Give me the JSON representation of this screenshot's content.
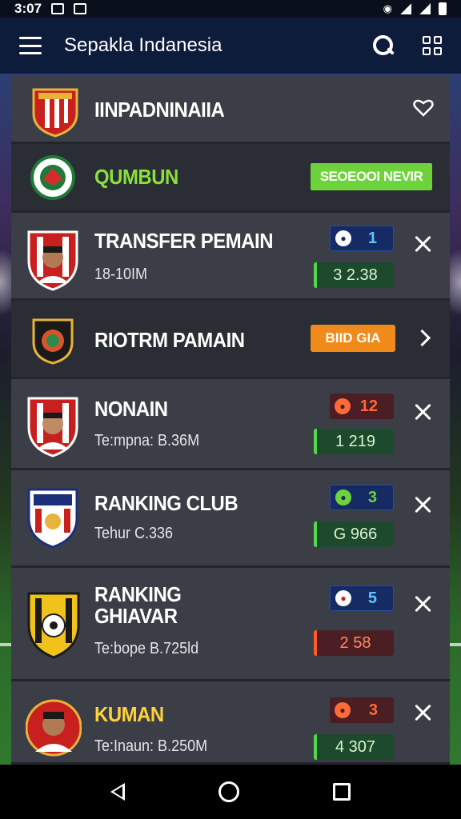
{
  "status_bar": {
    "time": "3:07"
  },
  "app_bar": {
    "title": "Sepakla Indanesia"
  },
  "icons": {
    "menu": "hamburger-menu-icon",
    "search": "search-icon",
    "grid": "grid-scan-icon",
    "close": "close-icon",
    "favorite": "heart-icon",
    "chevron": "chevron-right-icon"
  },
  "colors": {
    "accent_green": "#6ed33a",
    "accent_orange": "#f08a1a",
    "title_green": "#8be03a",
    "title_yellow": "#ffd23a",
    "app_bar": "#0e1c3c"
  },
  "list": {
    "header": {
      "title": "IINPADNINAIIA"
    },
    "promo": {
      "title": "QUMBUN",
      "button": "SEOEOOI NEVIR"
    },
    "items": [
      {
        "title": "TRANSFER PEMAIN",
        "subtitle": "18-10IM",
        "badge_value": "1",
        "stat": "3  2.38"
      },
      {
        "title": "RIOTRM PAMAIN",
        "button": "BIID GIA"
      },
      {
        "title": "NONAIN",
        "subtitle": "Te:mpna: B.36M",
        "badge_value": "12",
        "stat": "1  219"
      },
      {
        "title": "RANKING CLUB",
        "subtitle": "Tehur C.336",
        "badge_value": "3",
        "stat": "G  966"
      },
      {
        "title": "RANKING\nGHIAVAR",
        "subtitle": "Te:bope B.725ld",
        "badge_value": "5",
        "stat": "2  58"
      },
      {
        "title": "KUMAN",
        "subtitle": "Te:Inaun: B.250M",
        "badge_value": "3",
        "stat": "4  307"
      }
    ]
  }
}
